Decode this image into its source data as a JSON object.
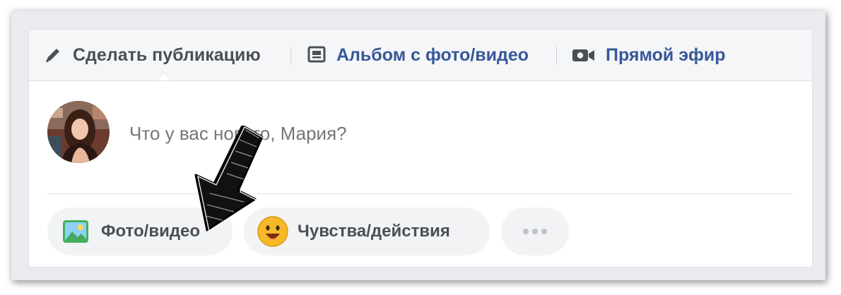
{
  "tabs": {
    "create_post": "Сделать публикацию",
    "photo_album": "Альбом с фото/видео",
    "live_video": "Прямой эфир"
  },
  "composer": {
    "placeholder": "Что у вас нового, Мария?"
  },
  "actions": {
    "photo_video": "Фото/видео",
    "feelings": "Чувства/действия",
    "more": "..."
  },
  "annotation": {
    "icon": "hand-drawn-arrow-icon"
  },
  "colors": {
    "link_blue": "#365899",
    "text_dark": "#4b4f56",
    "placeholder_grey": "#bec3c9",
    "pill_bg": "#f2f3f5",
    "tab_bar_bg": "#f5f6f7"
  }
}
